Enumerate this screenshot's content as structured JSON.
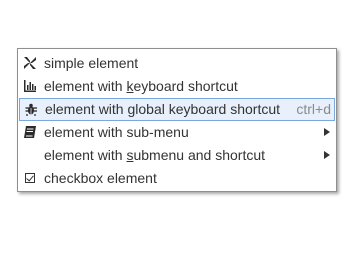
{
  "menu": {
    "items": [
      {
        "label": "simple element",
        "icon": "windmill-icon",
        "shortcut": "",
        "has_submenu": false
      },
      {
        "label_pre": "element with ",
        "label_u": "k",
        "label_post": "eyboard shortcut",
        "icon": "bar-chart-icon",
        "shortcut": "",
        "has_submenu": false
      },
      {
        "label": "element with global keyboard shortcut",
        "icon": "bug-icon",
        "shortcut": "ctrl+d",
        "has_submenu": false,
        "highlighted": true
      },
      {
        "label": "element with sub-menu",
        "icon": "book-icon",
        "shortcut": "",
        "has_submenu": true
      },
      {
        "label_pre": "element with ",
        "label_u": "s",
        "label_post": "ubmenu and shortcut",
        "icon": "",
        "shortcut": "",
        "has_submenu": true
      },
      {
        "label": "checkbox element",
        "icon": "checkbox-checked-icon",
        "checked": true,
        "shortcut": "",
        "has_submenu": false
      }
    ]
  },
  "colors": {
    "highlight_bg": "#e7f0fb",
    "highlight_border": "#7aa7e0",
    "text": "#333333",
    "shortcut_text": "#8a8a8a"
  }
}
